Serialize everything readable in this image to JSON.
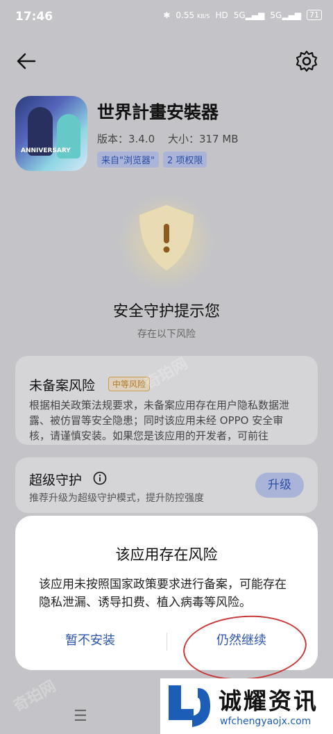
{
  "status_bar": {
    "time": "17:46",
    "network_speed": "0.55",
    "network_unit": "KB/S",
    "signal_a": "5G",
    "signal_b": "5G",
    "battery": "71"
  },
  "app": {
    "name": "世界計畫安裝器",
    "version_label": "版本：3.4.0",
    "size_label": "大小：317 MB",
    "source_tag": "来自\"浏览器\"",
    "permissions_tag": "2 项权限",
    "icon_text": "ANNIVERSARY"
  },
  "security": {
    "title": "安全守护提示您",
    "subtitle": "存在以下风险"
  },
  "risk_card": {
    "title": "未备案风险",
    "badge": "中等风险",
    "body": "根据相关政策法规要求，未备案应用存在用户隐私数据泄露、被仿冒等安全隐患；同时该应用未经 OPPO 安全审核，请谨慎安装。如果您是该应用的开发者，可前往"
  },
  "guard_card": {
    "title": "超级守护",
    "subtitle": "推荐升级为超级守护模式，提升防控强度",
    "button": "升级"
  },
  "dialog": {
    "title": "该应用存在风险",
    "body": "该应用未按照国家政策要求进行备案，可能存在隐私泄漏、诱导扣费、植入病毒等风险。",
    "cancel": "暂不安装",
    "continue": "仍然继续"
  },
  "logo": {
    "name": "诚耀资讯",
    "url": "wfchengyaojx.com"
  },
  "watermark": "奇珀网",
  "colors": {
    "accent_blue": "#2c55b0",
    "risk_orange": "#b47a28",
    "annotation_red": "#c83a3a"
  }
}
